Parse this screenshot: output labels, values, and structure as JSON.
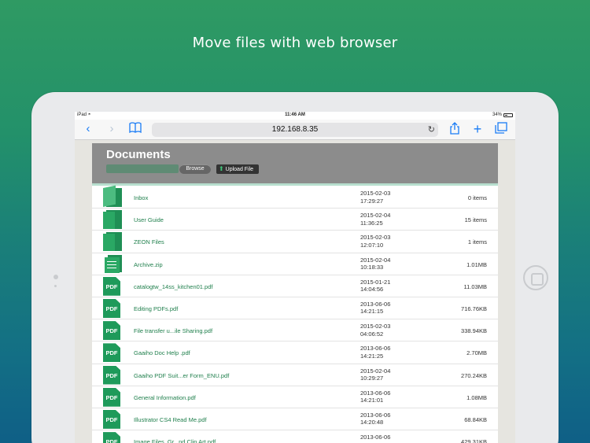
{
  "headline": "Move files with web browser",
  "status_bar": {
    "device": "iPad",
    "time": "11:46 AM",
    "battery": "34%"
  },
  "browser": {
    "url": "192.168.8.35"
  },
  "colors": {
    "accent": "#1f8f55",
    "header_gray": "#8c8c8c",
    "link_green": "#1f7f4c"
  },
  "documents": {
    "title": "Documents",
    "browse_label": "Browse",
    "upload_label": "Upload File",
    "files": [
      {
        "icon": "folder-open-icon",
        "name": "Inbox",
        "date": "2015-02-03",
        "time": "17:29:27",
        "size": "0 items"
      },
      {
        "icon": "folder-icon",
        "name": "User Guide",
        "date": "2015-02-04",
        "time": "11:36:25",
        "size": "15 items"
      },
      {
        "icon": "folder-icon",
        "name": "ZEON Files",
        "date": "2015-02-03",
        "time": "12:07:10",
        "size": "1 items"
      },
      {
        "icon": "zip-icon",
        "name": "Archive.zip",
        "date": "2015-02-04",
        "time": "10:18:33",
        "size": "1.01MB"
      },
      {
        "icon": "pdf-icon",
        "name": "catalogtw_14ss_kitchen01.pdf",
        "date": "2015-01-21",
        "time": "14:04:56",
        "size": "11.03MB"
      },
      {
        "icon": "pdf-icon",
        "name": "Editing PDFs.pdf",
        "date": "2013-06-06",
        "time": "14:21:15",
        "size": "716.76KB"
      },
      {
        "icon": "pdf-icon",
        "name": "File transfer u...ile Sharing.pdf",
        "date": "2015-02-03",
        "time": "04:06:52",
        "size": "338.94KB"
      },
      {
        "icon": "pdf-icon",
        "name": "Gaaiho Doc Help .pdf",
        "date": "2013-06-06",
        "time": "14:21:25",
        "size": "2.70MB"
      },
      {
        "icon": "pdf-icon",
        "name": "Gaaiho PDF Suit...er Form_ENU.pdf",
        "date": "2015-02-04",
        "time": "10:29:27",
        "size": "270.24KB"
      },
      {
        "icon": "pdf-icon",
        "name": "General Information.pdf",
        "date": "2013-06-06",
        "time": "14:21:01",
        "size": "1.08MB"
      },
      {
        "icon": "pdf-icon",
        "name": "Illustrator CS4 Read Me.pdf",
        "date": "2013-06-06",
        "time": "14:20:48",
        "size": "68.84KB"
      },
      {
        "icon": "pdf-icon",
        "name": "Image Files, Gr...nd Clip Art.pdf",
        "date": "2013-06-06",
        "time": "",
        "size": "429.31KB"
      }
    ],
    "pdf_label": "PDF"
  }
}
